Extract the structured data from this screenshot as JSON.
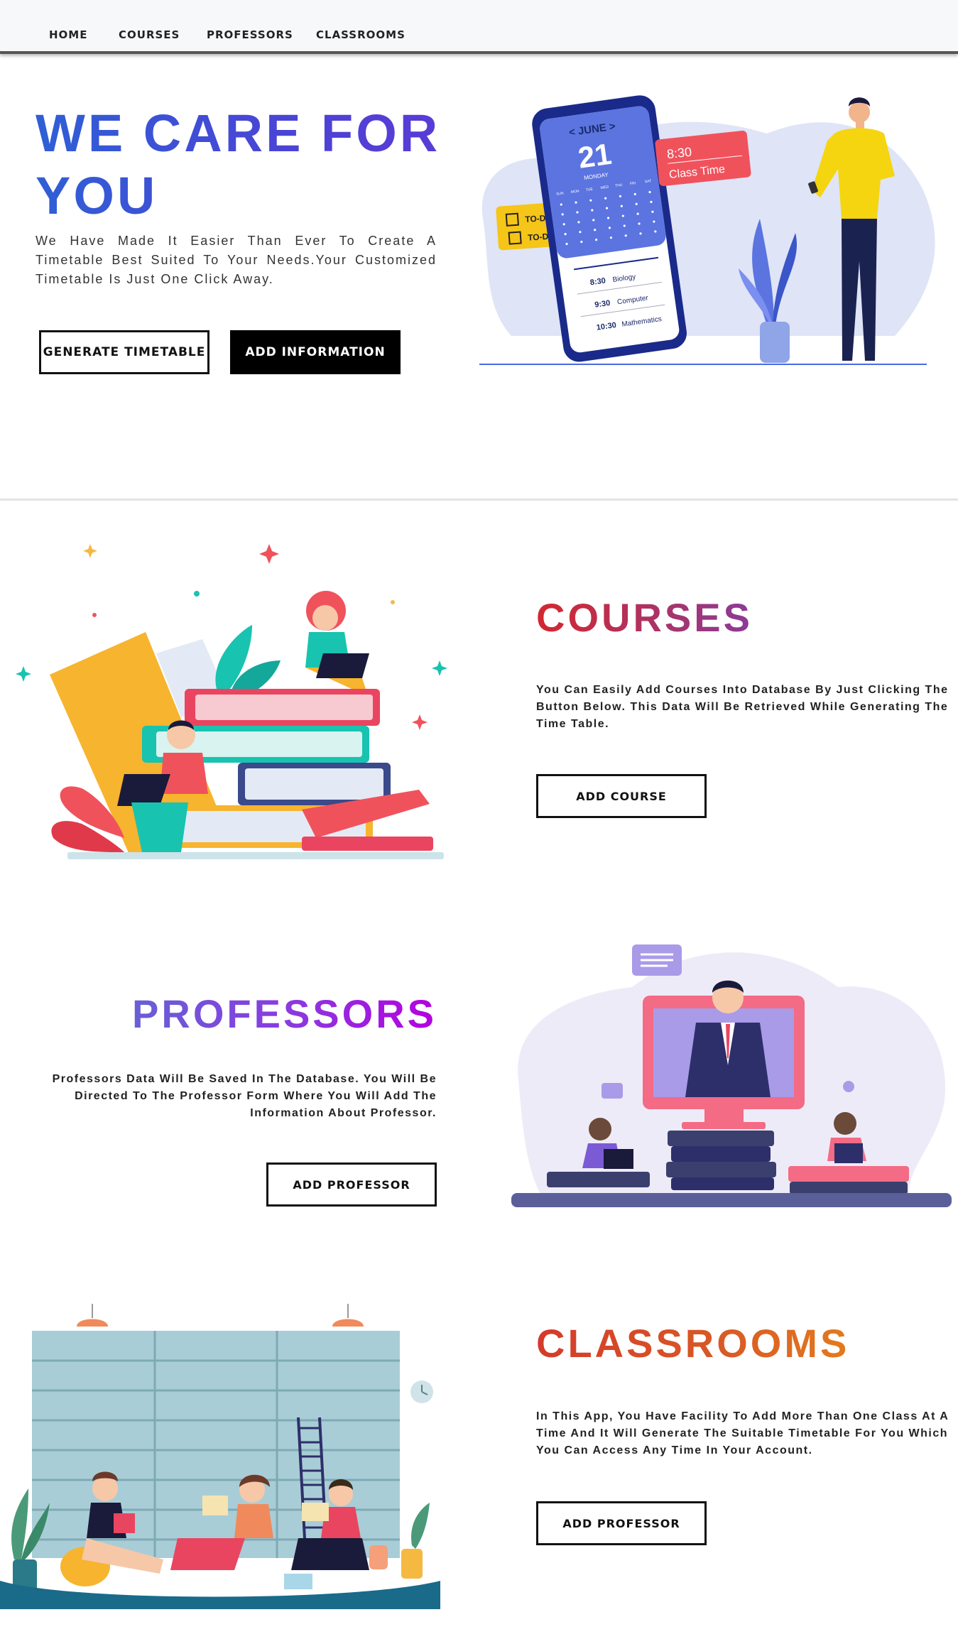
{
  "nav": {
    "items": [
      {
        "label": "HOME"
      },
      {
        "label": "COURSES"
      },
      {
        "label": "PROFESSORS"
      },
      {
        "label": "CLASSROOMS"
      }
    ]
  },
  "hero": {
    "title": "WE CARE FOR YOU",
    "description": "We Have Made It Easier Than Ever To Create A Timetable Best Suited To Your Needs.Your Customized Timetable Is Just One Click Away.",
    "generate_button": "GENERATE TIMETABLE",
    "add_info_button": "ADD INFORMATION",
    "illustration": {
      "month": "< JUNE >",
      "day": "21",
      "weekday": "MONDAY",
      "badge_time": "8:30",
      "badge_label": "Class Time",
      "todo_1": "TO-DO",
      "todo_2": "TO-DO",
      "weekday_headers": [
        "SUN",
        "MON",
        "TUE",
        "WED",
        "THU",
        "FRI",
        "SAT"
      ],
      "schedule": [
        {
          "time": "8:30",
          "subject": "Biology"
        },
        {
          "time": "9:30",
          "subject": "Computer"
        },
        {
          "time": "10:30",
          "subject": "Mathematics"
        }
      ]
    }
  },
  "courses": {
    "title": "COURSES",
    "description": "You Can Easily Add Courses Into Database By Just Clicking The Button Below. This Data Will Be Retrieved While Generating The Time Table.",
    "button": "ADD COURSE"
  },
  "professors": {
    "title": "PROFESSORS",
    "description": "Professors Data Will Be Saved In The Database. You Will Be Directed To The Professor Form Where You Will Add The Information About Professor.",
    "button": "ADD PROFESSOR"
  },
  "classrooms": {
    "title": "CLASSROOMS",
    "description": "In This App, You Have Facility To Add More Than One Class At A Time And It Will Generate The Suitable Timetable For You Which You Can Access Any Time In Your Account.",
    "button": "ADD PROFESSOR"
  },
  "colors": {
    "hero_gradient": [
      "#2f5fd6",
      "#5a3bd6"
    ],
    "courses_gradient": [
      "#d4272e",
      "#8b3a9a"
    ],
    "professors_gradient": [
      "#5a6fd0",
      "#b400e0"
    ],
    "classrooms_gradient": [
      "#d43a2a",
      "#e57a1c"
    ]
  }
}
